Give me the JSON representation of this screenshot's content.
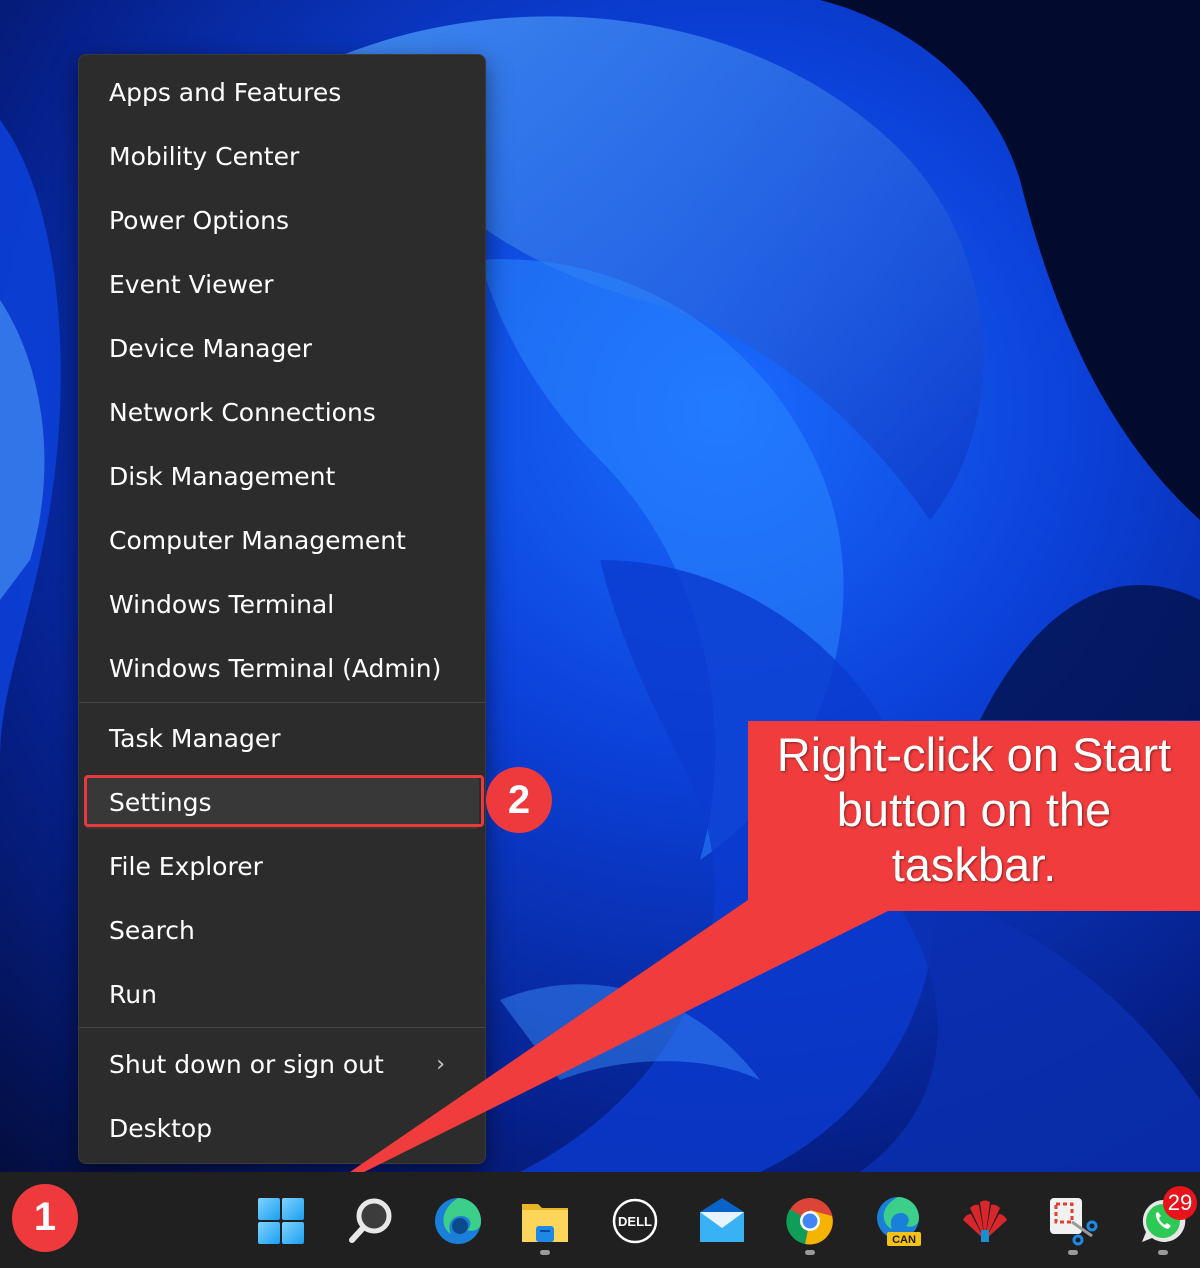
{
  "context_menu": {
    "groups": [
      [
        {
          "label": "Apps and Features"
        },
        {
          "label": "Mobility Center"
        },
        {
          "label": "Power Options"
        },
        {
          "label": "Event Viewer"
        },
        {
          "label": "Device Manager"
        },
        {
          "label": "Network Connections"
        },
        {
          "label": "Disk Management"
        },
        {
          "label": "Computer Management"
        },
        {
          "label": "Windows Terminal"
        },
        {
          "label": "Windows Terminal (Admin)"
        }
      ],
      [
        {
          "label": "Task Manager"
        },
        {
          "label": "Settings",
          "highlighted": true
        },
        {
          "label": "File Explorer"
        },
        {
          "label": "Search"
        },
        {
          "label": "Run"
        }
      ],
      [
        {
          "label": "Shut down or sign out",
          "submenu_icon": "chevron-right-icon"
        },
        {
          "label": "Desktop"
        }
      ]
    ]
  },
  "annotations": {
    "step1": "1",
    "step2": "2",
    "callout": [
      "Right-click on Start",
      "button on the",
      "taskbar."
    ],
    "accent_color": "#f03c3c"
  },
  "taskbar": {
    "icons": [
      {
        "name": "start-button",
        "icon": "windows-logo-icon",
        "running": false
      },
      {
        "name": "search-button",
        "icon": "search-icon",
        "running": false
      },
      {
        "name": "edge",
        "icon": "edge-icon",
        "running": false
      },
      {
        "name": "file-explorer",
        "icon": "folder-icon",
        "running": true
      },
      {
        "name": "dell",
        "icon": "dell-icon",
        "running": false
      },
      {
        "name": "mail",
        "icon": "mail-icon",
        "running": false
      },
      {
        "name": "chrome",
        "icon": "chrome-icon",
        "running": true
      },
      {
        "name": "edge-canary",
        "icon": "edge-canary-icon",
        "label": "CAN",
        "running": false
      },
      {
        "name": "huawei",
        "icon": "huawei-icon",
        "running": false
      },
      {
        "name": "snipping-tool",
        "icon": "snipping-tool-icon",
        "running": true
      },
      {
        "name": "whatsapp",
        "icon": "whatsapp-icon",
        "badge": "29",
        "running": true
      }
    ]
  }
}
